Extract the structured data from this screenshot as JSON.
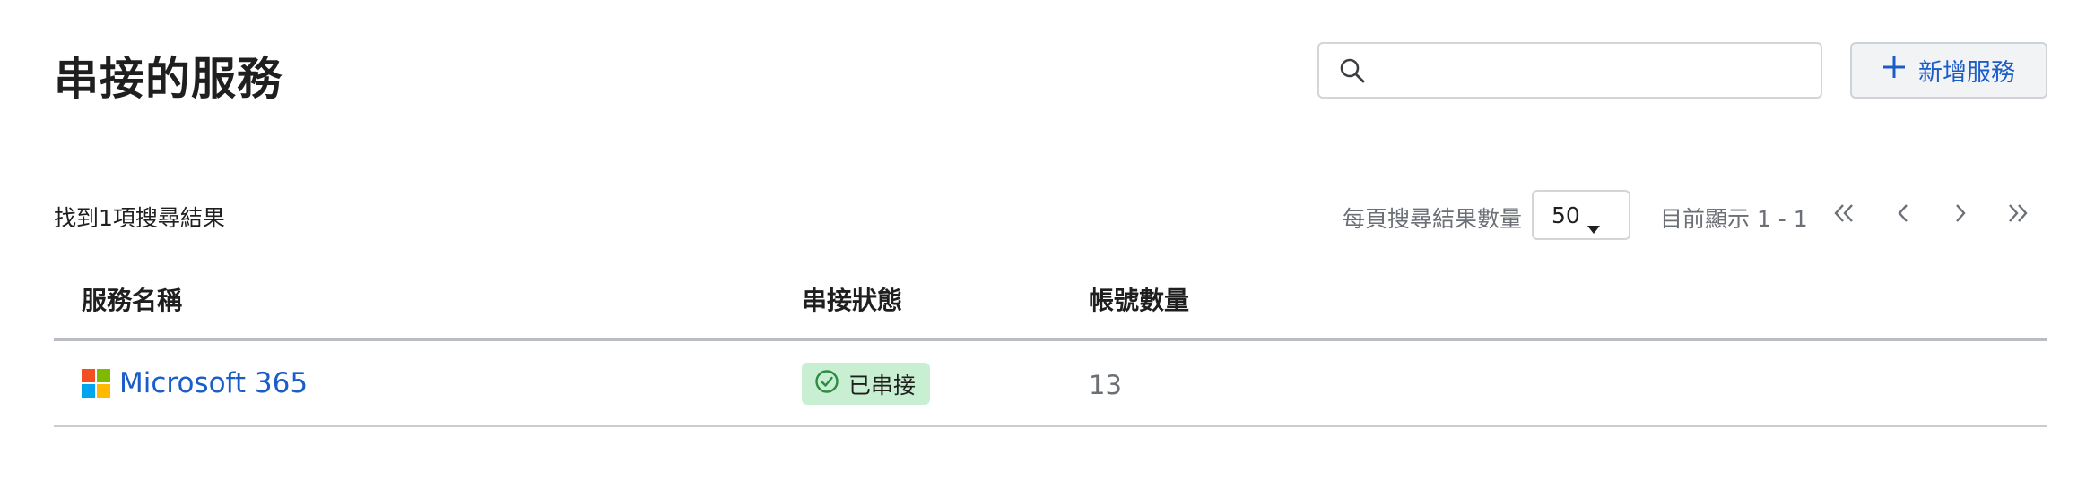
{
  "page": {
    "title": "串接的服務"
  },
  "search": {
    "placeholder": "",
    "value": ""
  },
  "toolbar": {
    "add_label": "新增服務"
  },
  "results": {
    "summary": "找到1項搜尋結果",
    "per_page_label": "每頁搜尋結果數量",
    "per_page_value": "50",
    "range_text": "目前顯示 1 - 1"
  },
  "pager": {
    "first_icon": "double-chevron-left-icon",
    "prev_icon": "chevron-left-icon",
    "next_icon": "chevron-right-icon",
    "last_icon": "double-chevron-right-icon"
  },
  "table": {
    "columns": [
      "服務名稱",
      "串接狀態",
      "帳號數量"
    ],
    "rows": [
      {
        "service": "Microsoft 365",
        "status": "已串接",
        "accounts": "13"
      }
    ]
  },
  "colors": {
    "link": "#1a5dc8",
    "badge_bg": "#c8efd1",
    "badge_icon": "#2e8b47",
    "ms_red": "#f25022",
    "ms_green": "#7fba00",
    "ms_blue": "#00a4ef",
    "ms_yellow": "#ffb900"
  }
}
